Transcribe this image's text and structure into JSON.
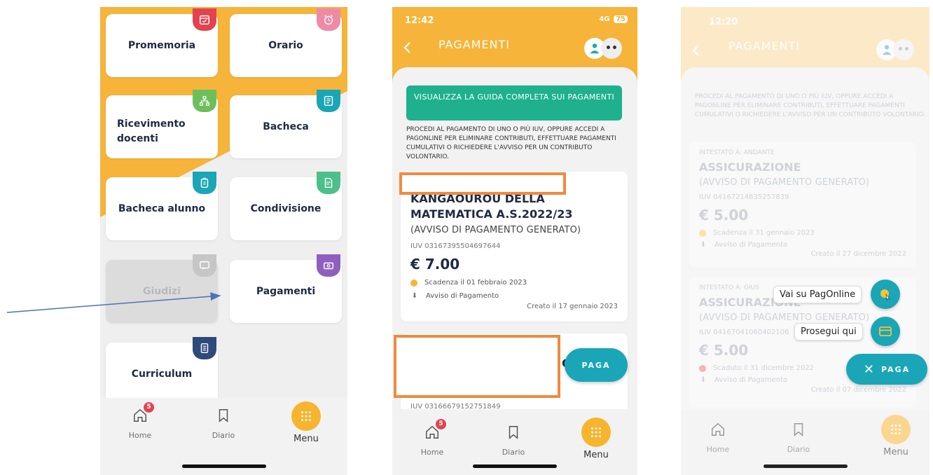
{
  "screen1": {
    "tiles": [
      {
        "label": "Promemoria",
        "icon": "calendar-icon",
        "color": "#e3434f"
      },
      {
        "label": "Orario",
        "icon": "alarm-clock-icon",
        "color": "#ef8aa5"
      },
      {
        "label": "Ricevimento docenti",
        "icon": "org-chart-icon",
        "color": "#6cbf5b"
      },
      {
        "label": "Bacheca",
        "icon": "board-icon",
        "color": "#1aa6b7"
      },
      {
        "label": "Bacheca alunno",
        "icon": "clipboard-icon",
        "color": "#1aa6b7"
      },
      {
        "label": "Condivisione",
        "icon": "share-doc-icon",
        "color": "#4cc08a"
      },
      {
        "label": "Giudizi",
        "icon": "comment-icon",
        "color": "#c6c6c6",
        "disabled": true
      },
      {
        "label": "Pagamenti",
        "icon": "money-icon",
        "color": "#8e5fbf"
      },
      {
        "label": "Curriculum",
        "icon": "cv-icon",
        "color": "#2d4a7a"
      }
    ],
    "nav": {
      "home": "Home",
      "diario": "Diario",
      "menu": "Menu",
      "badge": "5"
    }
  },
  "screen2": {
    "time": "12:42",
    "network": "4G",
    "battery": "75",
    "title": "PAGAMENTI",
    "guide_button": "VISUALIZZA LA GUIDA COMPLETA SUI PAGAMENTI",
    "intro": "PROCEDI AL PAGAMENTO DI UNO O PIÙ IUV, OPPURE ACCEDI A PAGONLINE PER ELIMINARE CONTRIBUTI, EFFETTUARE PAGAMENTI CUMULATIVI O RICHIEDERE L'AVVISO PER UN CONTRIBUTO VOLONTARIO.",
    "card1": {
      "title": "KANGAOUROU DELLA MATEMATICA A.S.2022/23",
      "status": "(AVVISO DI PAGAMENTO GENERATO)",
      "iuv": "IUV 03167395504697644",
      "amount": "€ 7.00",
      "due": "Scadenza il 01 febbraio 2023",
      "notice": "Avviso di Pagamento",
      "created": "Creato il 17 gennaio 2023"
    },
    "card2": {
      "partial_letter": "O",
      "iuv": "IUV 03166679152751849"
    },
    "paga_button": "PAGA",
    "nav": {
      "home": "Home",
      "diario": "Diario",
      "menu": "Menu",
      "badge": "5"
    }
  },
  "screen3": {
    "time": "12:20",
    "title": "PAGAMENTI",
    "intro": "PROCEDI AL PAGAMENTO DI UNO O PIÙ IUV, OPPURE ACCEDI A PAGONLINE PER ELIMINARE CONTRIBUTI, EFFETTUARE PAGAMENTI CUMULATIVI O RICHIEDERE L'AVVISO PER UN CONTRIBUTO VOLONTARIO.",
    "card1": {
      "holder": "INTESTATO A: ANDANTE",
      "title": "ASSICURAZIONE",
      "status": "(AVVISO DI PAGAMENTO GENERATO)",
      "iuv": "IUV 04167214835257839",
      "amount": "€ 5.00",
      "due": "Scadenza il 31 gennaio 2023",
      "notice": "Avviso di Pagamento",
      "created": "Creato il 27 dicembre 2022"
    },
    "card2": {
      "holder": "INTESTATO A: GIUS",
      "title": "ASSICURAZIONE",
      "status": "(AVVISO DI PAGAMENTO GENERATO)",
      "iuv": "IUV 04167041060402106",
      "amount": "€ 5.00",
      "due": "Scaduto il 31 dicembre 2022",
      "notice": "Avviso di Pagamento",
      "created": "Creato il 07 dicembre 2022"
    },
    "fab": {
      "pagonline": "Vai su PagOnline",
      "prosegui": "Prosegui qui",
      "paga": "PAGA"
    },
    "nav": {
      "home": "Home",
      "diario": "Diario",
      "menu": "Menu"
    }
  }
}
